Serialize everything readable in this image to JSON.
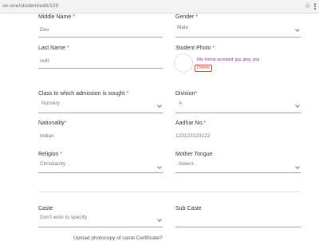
{
  "browser": {
    "url": "se-one/student/edit/129"
  },
  "fields": {
    "middle_name": {
      "label": "Middle Name",
      "value": "Dev"
    },
    "gender": {
      "label": "Gender",
      "value": "Male"
    },
    "last_name": {
      "label": "Last Name",
      "value": "redt"
    },
    "student_photo": {
      "label": "Student Photo",
      "hint": "File format accepted: jpg, jpeg, png",
      "delete_label": "Delete"
    },
    "class_admission": {
      "label": "Class to which admission is sought",
      "value": "Nursery"
    },
    "division": {
      "label": "Division",
      "value": "A"
    },
    "nationality": {
      "label": "Nationality",
      "value": "Indian"
    },
    "aadhaar": {
      "label": "Aadhar No.",
      "value": "123123123122"
    },
    "religion": {
      "label": "Religion",
      "value": "Christianity"
    },
    "mother_tongue": {
      "label": "Mother Tongue",
      "value": "-Select-"
    },
    "caste": {
      "label": "Caste",
      "value": "Don't wish to specify"
    },
    "sub_caste": {
      "label": "Sub Caste",
      "value": ""
    }
  },
  "footer_text": "Upload photocopy of caste Certificate?",
  "required_marker": "*"
}
